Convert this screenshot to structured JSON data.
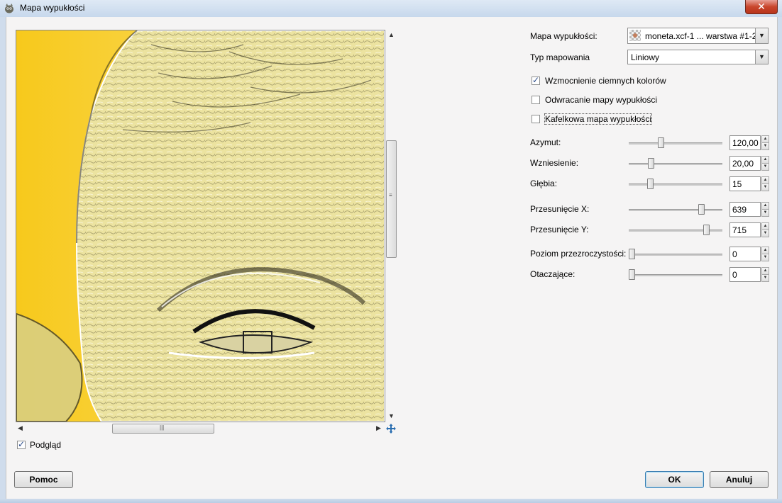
{
  "window": {
    "title": "Mapa wypukłości",
    "close_label": "✕"
  },
  "preview": {
    "checkbox_label": "Podgląd",
    "checked": true
  },
  "bump_map": {
    "label": "Mapa wypukłości:",
    "value": "moneta.xcf-1 ... warstwa #1-2"
  },
  "map_type": {
    "label": "Typ mapowania",
    "value": "Liniowy"
  },
  "options": [
    {
      "label": "Wzmocnienie ciemnych kolorów",
      "checked": true
    },
    {
      "label": "Odwracanie mapy wypukłości",
      "checked": false
    },
    {
      "label": "Kafelkowa mapa wypukłości",
      "checked": false
    }
  ],
  "sliders": [
    {
      "label": "Azymut:",
      "value": "120,00",
      "fraction": 0.333
    },
    {
      "label": "Wzniesienie:",
      "value": "20,00",
      "fraction": 0.222
    },
    {
      "label": "Głębia:",
      "value": "15",
      "fraction": 0.215
    },
    {
      "label": "Przesunięcie X:",
      "value": "639",
      "fraction": 0.8
    },
    {
      "label": "Przesunięcie Y:",
      "value": "715",
      "fraction": 0.85
    },
    {
      "label": "Poziom przezroczystości:",
      "value": "0",
      "fraction": 0.0
    },
    {
      "label": "Otaczające:",
      "value": "0",
      "fraction": 0.0
    }
  ],
  "buttons": {
    "help": "Pomoc",
    "ok": "OK",
    "cancel": "Anuluj"
  }
}
